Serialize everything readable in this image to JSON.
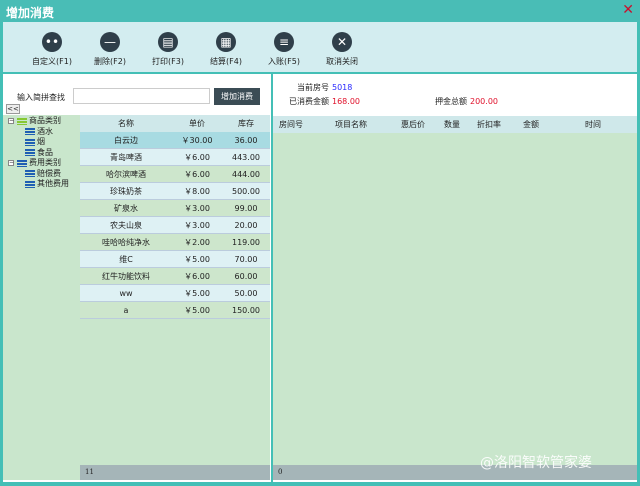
{
  "window": {
    "title": "增加消费",
    "close_icon": "close-icon"
  },
  "toolbar": [
    {
      "label": "自定义(F1)",
      "icon": "dots-icon",
      "glyph": "••"
    },
    {
      "label": "删除(F2)",
      "icon": "minus-icon",
      "glyph": "—"
    },
    {
      "label": "打印(F3)",
      "icon": "printer-icon",
      "glyph": "▤"
    },
    {
      "label": "结算(F4)",
      "icon": "calculator-icon",
      "glyph": "▦"
    },
    {
      "label": "入账(F5)",
      "icon": "menu-icon",
      "glyph": "≡"
    },
    {
      "label": "取消关闭",
      "icon": "close-circle-icon",
      "glyph": "✕"
    }
  ],
  "search": {
    "label": "输入简拼查找",
    "value": "",
    "button": "增加消费",
    "collapse": "<<"
  },
  "tree": [
    {
      "label": "商品类别",
      "level": 0,
      "toggle": "−",
      "color": "#86c832"
    },
    {
      "label": "酒水",
      "level": 1
    },
    {
      "label": "烟",
      "level": 1
    },
    {
      "label": "食品",
      "level": 1
    },
    {
      "label": "费用类别",
      "level": 0,
      "toggle": "−",
      "color": "#1f5fb3"
    },
    {
      "label": "赔偿费",
      "level": 1
    },
    {
      "label": "其他费用",
      "level": 1
    }
  ],
  "goods": {
    "headers": [
      "名称",
      "单价",
      "库存"
    ],
    "rows": [
      [
        "白云边",
        "￥30.00",
        "36.00"
      ],
      [
        "青岛啤酒",
        "￥6.00",
        "443.00"
      ],
      [
        "哈尔滨啤酒",
        "￥6.00",
        "444.00"
      ],
      [
        "珍珠奶茶",
        "￥8.00",
        "500.00"
      ],
      [
        "矿泉水",
        "￥3.00",
        "99.00"
      ],
      [
        "农夫山泉",
        "￥3.00",
        "20.00"
      ],
      [
        "哇哈哈纯净水",
        "￥2.00",
        "119.00"
      ],
      [
        "维C",
        "￥5.00",
        "70.00"
      ],
      [
        "红牛功能饮料",
        "￥6.00",
        "60.00"
      ],
      [
        "ww",
        "￥5.00",
        "50.00"
      ],
      [
        "a",
        "￥5.00",
        "150.00"
      ]
    ],
    "count": "11"
  },
  "info": {
    "room_label": "当前房号",
    "room": "5018",
    "spent_label": "已消费金额",
    "spent": "168.00",
    "deposit_label": "押金总额",
    "deposit": "200.00"
  },
  "consumption": {
    "headers": [
      "房间号",
      "项目名称",
      "惠后价",
      "数量",
      "折扣率",
      "金额",
      "时间"
    ],
    "count": "0"
  },
  "colors": {
    "title": "#49bdb6",
    "toolbar": "#d3edf0",
    "grid": "#c9e6cc",
    "selected": "#a8dbe2",
    "room": "#2a2aff",
    "money": "#e0102a"
  },
  "watermark": "@洛阳智软管家婆"
}
